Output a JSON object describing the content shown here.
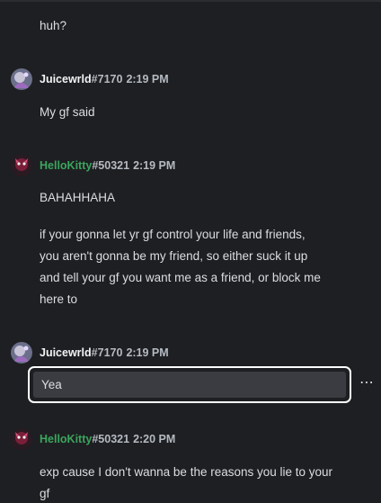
{
  "messages": [
    {
      "text_lines": [
        "huh?"
      ]
    },
    {
      "author": "Juicewrld",
      "tag": "#7170",
      "time": "2:19 PM",
      "text_lines": [
        "My gf said"
      ]
    },
    {
      "author": "HelloKitty",
      "tag": "#50321",
      "time": "2:19 PM",
      "paragraph1": [
        "BAHAHHAHA"
      ],
      "paragraph2": [
        "if your gonna let yr gf control your life and friends,",
        "you aren't gonna be my friend, so either suck it up",
        "and tell your gf you want me as a friend, or block me",
        "here to"
      ]
    },
    {
      "author": "Juicewrld",
      "tag": "#7170",
      "time": "2:19 PM",
      "text_lines": [
        "Yea"
      ]
    },
    {
      "author": "HelloKitty",
      "tag": "#50321",
      "time": "2:20 PM",
      "text_lines": [
        "exp cause I don't wanna be the reasons you lie to your",
        "gf"
      ]
    }
  ],
  "icons": {
    "more": "more-options-icon",
    "avatar_juice": "juicewrld-avatar",
    "avatar_kitty": "hellokitty-avatar"
  },
  "colors": {
    "background": "#1e1f22",
    "username_default": "#f2f3f5",
    "username_green": "#3ba55d",
    "muted": "#b5bac1",
    "text": "#dbdee1",
    "edit_bg": "#3a3c41",
    "edit_border": "#ffffff"
  }
}
